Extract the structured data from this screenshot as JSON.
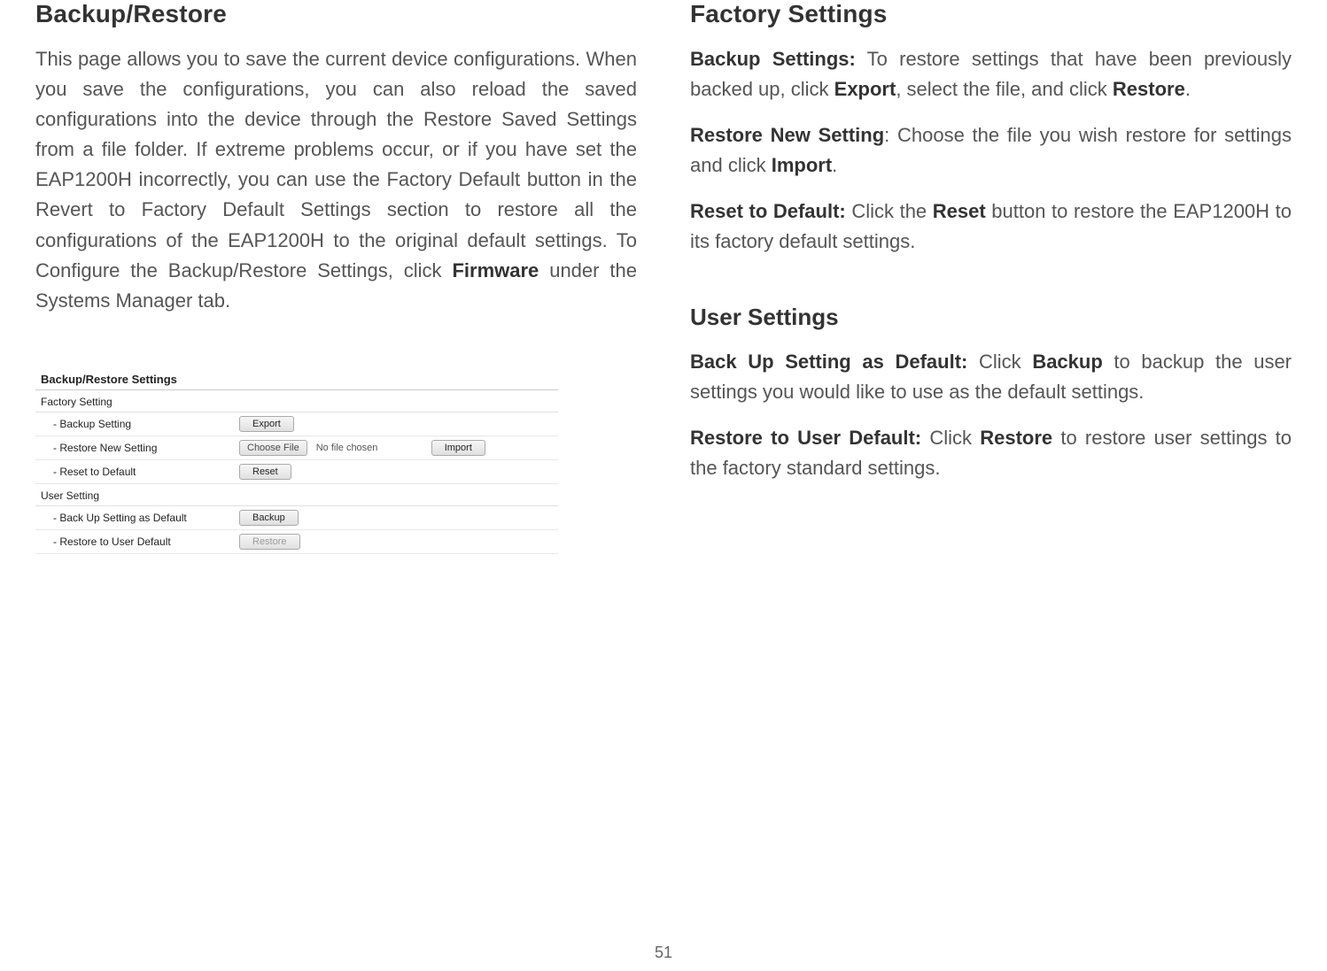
{
  "page_number": "51",
  "left": {
    "heading": "Backup/Restore",
    "para_pre": "This page allows you to save the current device configurations. When you save the configurations, you can also reload the saved configurations into the device through the Restore Saved Settings from a file folder. If extreme problems occur, or if you have set the EAP1200H incorrectly, you can use the Factory Default button in the Revert to Factory Default Settings section to restore all the configurations of the EAP1200H to the original default settings. To Configure the Backup/Restore Settings, click ",
    "para_bold": "Firmware",
    "para_post": " under the Systems Manager tab.",
    "screenshot": {
      "title": "Backup/Restore Settings",
      "group_factory": "Factory Setting",
      "rows_factory": {
        "backup": {
          "label": "- Backup Setting",
          "btn": "Export"
        },
        "restore": {
          "label": "- Restore New Setting",
          "choose": "Choose File",
          "nofile": "No file chosen",
          "btn": "Import"
        },
        "reset": {
          "label": "- Reset to Default",
          "btn": "Reset"
        }
      },
      "group_user": "User Setting",
      "rows_user": {
        "backup": {
          "label": "- Back Up Setting as Default",
          "btn": "Backup"
        },
        "restore": {
          "label": "- Restore to User Default",
          "btn": "Restore"
        }
      }
    }
  },
  "right": {
    "heading": "Factory Settings",
    "p1": {
      "b1": "Backup Settings:",
      "t1": " To restore settings that have been previously backed up, click ",
      "b2": "Export",
      "t2": ", select the file, and click ",
      "b3": "Restore",
      "t3": "."
    },
    "p2": {
      "b1": "Restore New Setting",
      "t1": ": Choose the file you wish restore for settings and click ",
      "b2": "Import",
      "t2": "."
    },
    "p3": {
      "b1": "Reset to Default:",
      "t1": " Click the ",
      "b2": "Reset",
      "t2": " button to restore the EAP1200H to its factory default settings."
    },
    "sub": "User Settings",
    "p4": {
      "b1": "Back Up Setting as Default:",
      "t1": " Click ",
      "b2": "Backup",
      "t2": " to backup the user settings you would like to use as the default settings."
    },
    "p5": {
      "b1": "Restore to User Default:",
      "t1": " Click ",
      "b2": "Restore",
      "t2": " to restore user settings to the factory standard settings."
    }
  }
}
